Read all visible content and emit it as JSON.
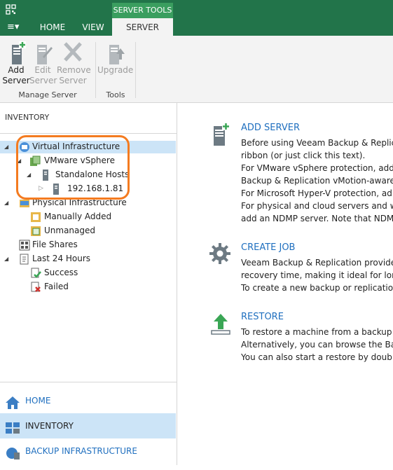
{
  "titlebar": {
    "app_icon": "veeam-logo-icon",
    "context_tab_group": "SERVER TOOLS"
  },
  "tabs": [
    {
      "label": "HOME"
    },
    {
      "label": "VIEW"
    },
    {
      "label": "SERVER"
    }
  ],
  "menu_button": {
    "icon": "hamburger-menu-icon",
    "glyph": "≡▾"
  },
  "ribbon": {
    "groups": [
      {
        "label": "Manage Server",
        "buttons": [
          {
            "line1": "Add",
            "line2": "Server",
            "enabled": true,
            "icon": "add-server-icon"
          },
          {
            "line1": "Edit",
            "line2": "Server",
            "enabled": false,
            "icon": "edit-server-icon"
          },
          {
            "line1": "Remove",
            "line2": "Server",
            "enabled": false,
            "icon": "remove-server-icon"
          }
        ]
      },
      {
        "label": "Tools",
        "buttons": [
          {
            "line1": "Upgrade",
            "line2": "",
            "enabled": false,
            "icon": "upgrade-icon"
          }
        ]
      }
    ]
  },
  "inventory": {
    "header": "INVENTORY",
    "tree": [
      {
        "label": "Virtual Infrastructure",
        "selected": true
      },
      {
        "label": "VMware vSphere"
      },
      {
        "label": "Standalone Hosts"
      },
      {
        "label": "192.168.1.81"
      },
      {
        "label": "Physical Infrastructure"
      },
      {
        "label": "Manually Added"
      },
      {
        "label": "Unmanaged"
      },
      {
        "label": "File Shares"
      },
      {
        "label": "Last 24 Hours"
      },
      {
        "label": "Success"
      },
      {
        "label": "Failed"
      }
    ]
  },
  "nav": [
    {
      "label": "HOME",
      "icon": "home-icon"
    },
    {
      "label": "INVENTORY",
      "icon": "inventory-icon",
      "active": true
    },
    {
      "label": "BACKUP INFRASTRUCTURE",
      "icon": "backup-infrastructure-icon"
    }
  ],
  "content": {
    "add_server": {
      "title": "ADD SERVER",
      "lines": [
        "Before using Veeam Backup & Replica",
        "ribbon (or just click this text).",
        "For VMware vSphere protection, add",
        "Backup & Replication vMotion-aware.",
        "For Microsoft Hyper-V protection, ad",
        "For physical and cloud servers and w",
        "add an NDMP server. Note that NDM"
      ]
    },
    "create_job": {
      "title": "CREATE JOB",
      "lines": [
        "Veeam Backup & Replication provide",
        "recovery time, making it ideal for long",
        "To create a new backup or replicatio"
      ]
    },
    "restore": {
      "title": "RESTORE",
      "lines": [
        "To restore a machine from a backup",
        "Alternatively, you can browse the Back",
        "You can also start a restore by doubl"
      ]
    }
  },
  "colors": {
    "accent_green": "#22744a",
    "selection": "#cce4f7",
    "highlight_orange": "#f47b20",
    "link_blue": "#1f6fbf"
  }
}
